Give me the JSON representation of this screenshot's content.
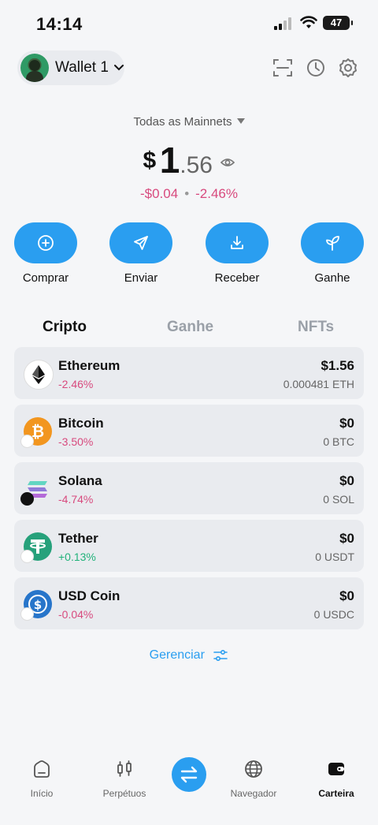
{
  "status_bar": {
    "time": "14:14",
    "battery": "47"
  },
  "header": {
    "wallet_name": "Wallet 1"
  },
  "network_selector": {
    "label": "Todas as Mainnets"
  },
  "balance": {
    "currency": "$",
    "integer": "1",
    "decimal": ".56",
    "change_usd": "-$0.04",
    "change_pct": "-2.46%"
  },
  "actions": [
    {
      "label": "Comprar",
      "icon": "plus-circle-icon"
    },
    {
      "label": "Enviar",
      "icon": "send-icon"
    },
    {
      "label": "Receber",
      "icon": "download-icon"
    },
    {
      "label": "Ganhe",
      "icon": "sprout-icon"
    }
  ],
  "tabs": [
    {
      "label": "Cripto",
      "active": true
    },
    {
      "label": "Ganhe",
      "active": false
    },
    {
      "label": "NFTs",
      "active": false
    }
  ],
  "tokens": [
    {
      "name": "Ethereum",
      "change": "-2.46%",
      "value": "$1.56",
      "amount": "0.000481 ETH",
      "icon": "ethereum-icon"
    },
    {
      "name": "Bitcoin",
      "change": "-3.50%",
      "value": "$0",
      "amount": "0 BTC",
      "icon": "bitcoin-icon"
    },
    {
      "name": "Solana",
      "change": "-4.74%",
      "value": "$0",
      "amount": "0 SOL",
      "icon": "solana-icon"
    },
    {
      "name": "Tether",
      "change": "+0.13%",
      "value": "$0",
      "amount": "0 USDT",
      "icon": "tether-icon"
    },
    {
      "name": "USD Coin",
      "change": "-0.04%",
      "value": "$0",
      "amount": "0 USDC",
      "icon": "usdc-icon"
    }
  ],
  "manage_label": "Gerenciar",
  "bottom_nav": [
    {
      "label": "Início",
      "icon": "home-icon"
    },
    {
      "label": "Perpétuos",
      "icon": "candlestick-icon"
    },
    {
      "label": "",
      "icon": "swap-icon"
    },
    {
      "label": "Navegador",
      "icon": "globe-icon"
    },
    {
      "label": "Carteira",
      "icon": "wallet-icon",
      "active": true
    }
  ],
  "colors": {
    "accent": "#2a9ef0",
    "negative": "#d84a7e",
    "positive": "#21b27a",
    "card": "#e9ebef",
    "background": "#f5f6f8"
  }
}
